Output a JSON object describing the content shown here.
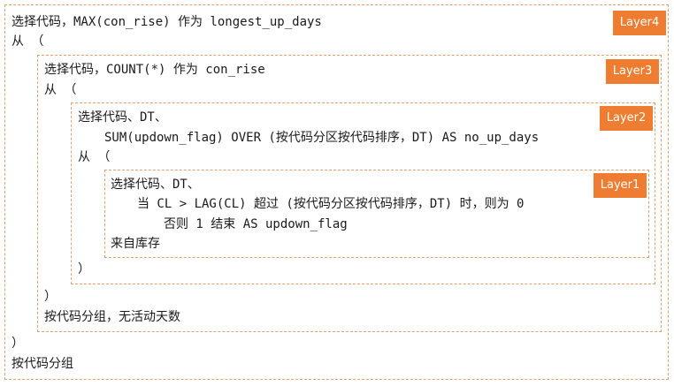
{
  "layer4": {
    "badge": "Layer4",
    "line1": "选择代码，MAX(con_rise) 作为 longest_up_days",
    "line2": "从 （",
    "close": "）",
    "group": "按代码分组"
  },
  "layer3": {
    "badge": "Layer3",
    "line1": "选择代码，COUNT(*) 作为 con_rise",
    "line2": "从 （",
    "close": "）",
    "group": "按代码分组，无活动天数"
  },
  "layer2": {
    "badge": "Layer2",
    "line1": "选择代码、DT、",
    "line2": "SUM(updown_flag) OVER (按代码分区按代码排序，DT) AS no_up_days",
    "line3": "从 （",
    "close": "）"
  },
  "layer1": {
    "badge": "Layer1",
    "line1": "选择代码、DT、",
    "line2": "当 CL > LAG(CL) 超过 (按代码分区按代码排序，DT) 时，则为 0",
    "line3": "否则 1 结束 AS updown_flag",
    "line4": "来自库存"
  },
  "colors": {
    "badge": "#ee7d31",
    "border": "#e0a070"
  }
}
